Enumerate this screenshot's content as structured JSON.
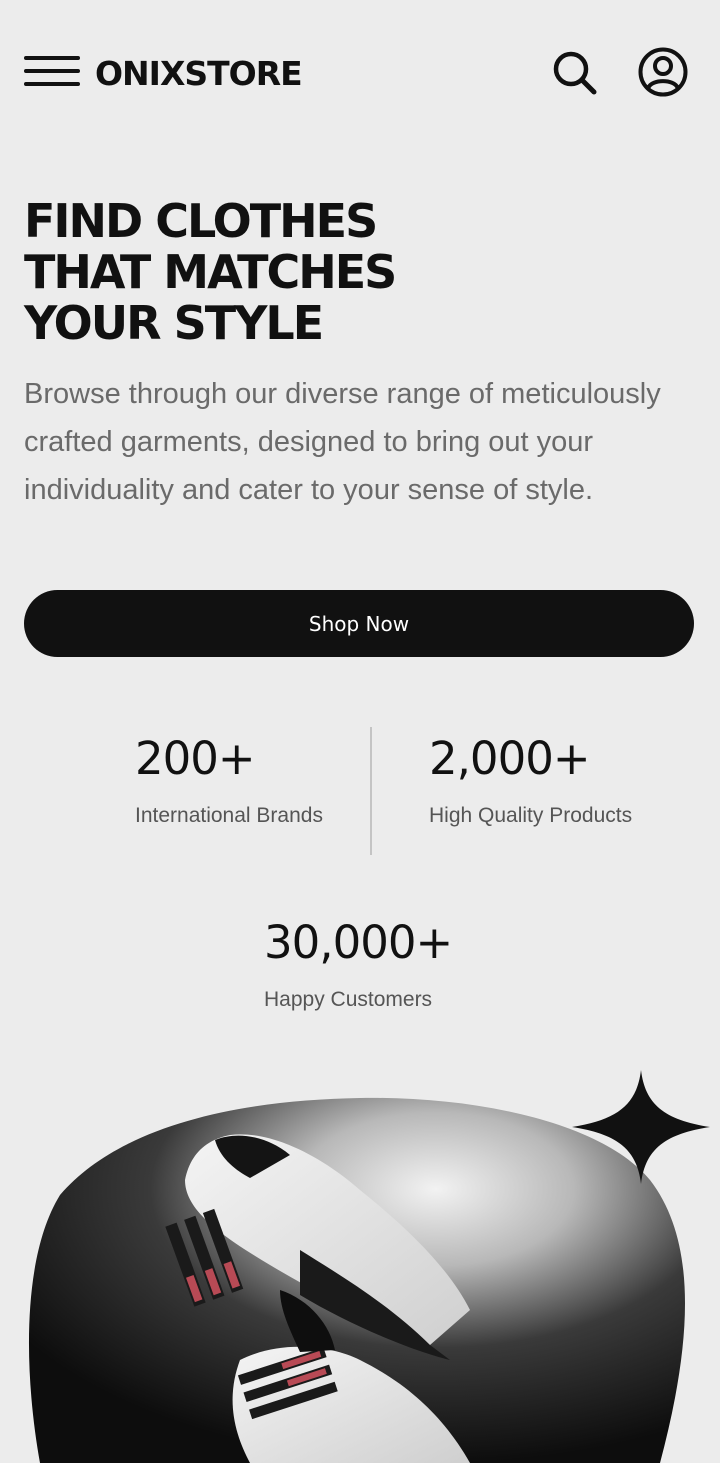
{
  "header": {
    "logo": "ONIXSTORE",
    "icons": {
      "menu": "hamburger-menu-icon",
      "search": "search-icon",
      "account": "user-account-icon"
    }
  },
  "hero": {
    "title_lines": [
      "FIND CLOTHES",
      "THAT MATCHES",
      "YOUR STYLE"
    ],
    "description": "Browse through our diverse range of meticulously crafted garments, designed to bring out your individuality and cater to your sense of style.",
    "cta_label": "Shop Now"
  },
  "stats": [
    {
      "value": "200+",
      "label": "International Brands"
    },
    {
      "value": "2,000+",
      "label": "High Quality Products"
    },
    {
      "value": "30,000+",
      "label": "Happy Customers"
    }
  ],
  "colors": {
    "background": "#ececec",
    "primary": "#111111",
    "muted_text": "#6a6a6a",
    "shoe_stripe_accent": "#b84a55"
  }
}
